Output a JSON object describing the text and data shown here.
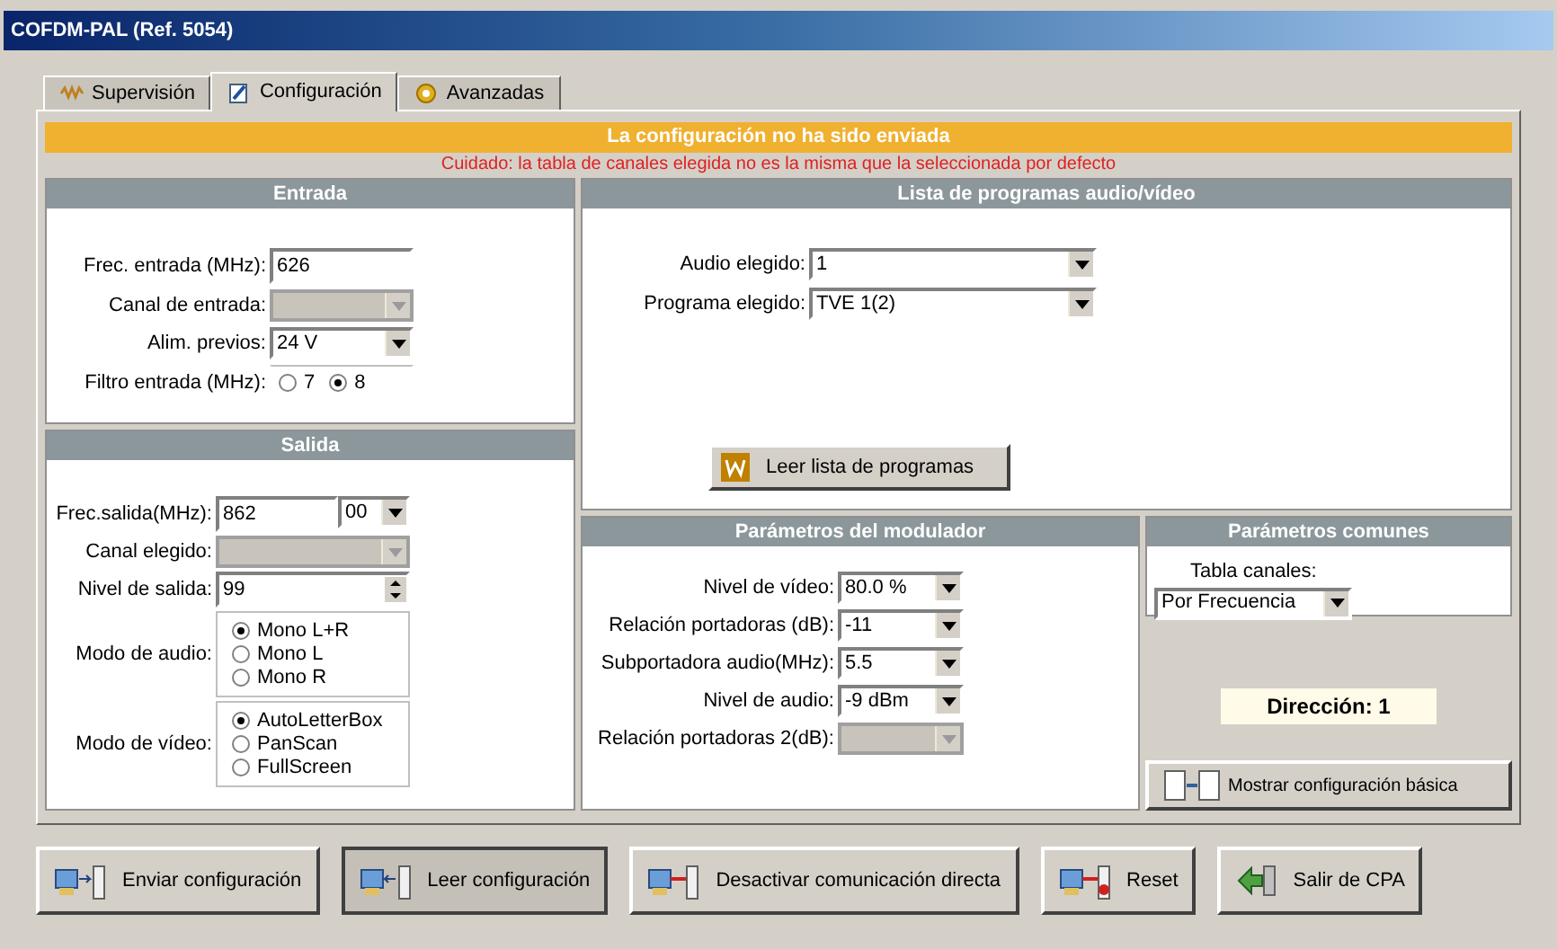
{
  "window": {
    "title": "COFDM-PAL (Ref. 5054)"
  },
  "tabs": [
    {
      "label": "Supervisión",
      "selected": false
    },
    {
      "label": "Configuración",
      "selected": true
    },
    {
      "label": "Avanzadas",
      "selected": false
    }
  ],
  "banner": "La configuración no ha sido enviada",
  "warning": "Cuidado: la tabla de canales elegida no es la misma que la seleccionada por defecto",
  "entrada": {
    "title": "Entrada",
    "rows": [
      {
        "kind": "input",
        "label": "Frec. entrada (MHz):",
        "value": "626"
      },
      {
        "kind": "select",
        "label": "Canal de entrada:",
        "disabled": true
      },
      {
        "kind": "select",
        "label": "Alim. previos:",
        "value": "24 V",
        "disabled": false
      },
      {
        "kind": "radio_inline",
        "label": "Filtro entrada (MHz):",
        "options": [
          {
            "label": "7",
            "selected": false
          },
          {
            "label": "8",
            "selected": true
          }
        ]
      }
    ]
  },
  "salida": {
    "title": "Salida",
    "rows": [
      {
        "kind": "input_select",
        "label": "Frec.salida(MHz):",
        "value": "862",
        "unit": "00"
      },
      {
        "kind": "select",
        "label": "Canal elegido:",
        "disabled": true
      },
      {
        "kind": "spin",
        "label": "Nivel de salida:",
        "value": "99"
      },
      {
        "kind": "radio",
        "label": "Modo de audio:",
        "options": [
          {
            "label": "Mono L+R",
            "selected": true
          },
          {
            "label": "Mono L",
            "selected": false
          },
          {
            "label": "Mono R",
            "selected": false
          }
        ]
      },
      {
        "kind": "radio",
        "label": "Modo de vídeo:",
        "options": [
          {
            "label": "AutoLetterBox",
            "selected": true
          },
          {
            "label": "PanScan",
            "selected": false
          },
          {
            "label": "FullScreen",
            "selected": false
          }
        ]
      }
    ]
  },
  "programas": {
    "title": "Lista de programas audio/vídeo",
    "rows": [
      {
        "kind": "select",
        "label": "Audio elegido:",
        "value": "1",
        "disabled": false
      },
      {
        "kind": "select",
        "label": "Programa elegido:",
        "value": "TVE 1(2)",
        "disabled": false
      }
    ],
    "button": "Leer lista de programas"
  },
  "modulador": {
    "title": "Parámetros del modulador",
    "rows": [
      {
        "kind": "select",
        "label": "Nivel de vídeo:",
        "value": "80.0 %",
        "disabled": false
      },
      {
        "kind": "select",
        "label": "Relación portadoras (dB):",
        "value": "-11",
        "disabled": false
      },
      {
        "kind": "select",
        "label": "Subportadora audio(MHz):",
        "value": "5.5",
        "disabled": false
      },
      {
        "kind": "select",
        "label": "Nivel de audio:",
        "value": "-9 dBm",
        "disabled": false
      },
      {
        "kind": "select",
        "label": "Relación portadoras 2(dB):",
        "disabled": true
      }
    ]
  },
  "comunes": {
    "title": "Parámetros comunes",
    "label": "Tabla canales:",
    "value": "Por Frecuencia"
  },
  "direccion": "Dirección: 1",
  "mostrar_button": "Mostrar configuración básica",
  "buttons": [
    {
      "label": "Enviar configuración",
      "pressed": false
    },
    {
      "label": "Leer configuración",
      "pressed": true
    },
    {
      "label": "Desactivar comunicación directa",
      "pressed": false
    },
    {
      "label": "Reset",
      "pressed": false
    },
    {
      "label": "Salir de CPA",
      "pressed": false
    }
  ]
}
